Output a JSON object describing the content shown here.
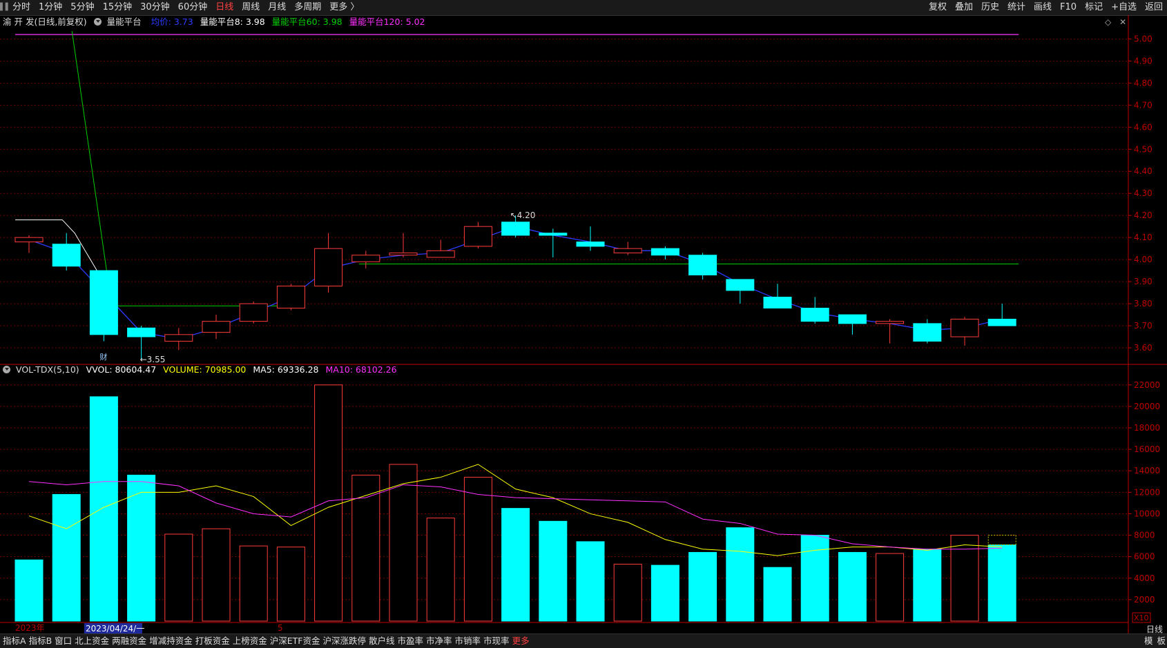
{
  "toolbar": {
    "periods": [
      "分时",
      "1分钟",
      "5分钟",
      "15分钟",
      "30分钟",
      "60分钟",
      "日线",
      "周线",
      "月线",
      "多周期",
      "更多 〉"
    ],
    "active_period": "日线",
    "right_items": [
      "复权",
      "叠加",
      "历史",
      "统计",
      "画线",
      "F10",
      "标记",
      "+自选",
      "返回"
    ]
  },
  "price_header": {
    "stock": "渝 开 发(日线,前复权)",
    "indicator": "量能平台",
    "items": [
      {
        "label": "均价: 3.73",
        "color": "#2a3cff"
      },
      {
        "label": "量能平台8: 3.98",
        "color": "#ffffff"
      },
      {
        "label": "量能平台60: 3.98",
        "color": "#00d000"
      },
      {
        "label": "量能平台120: 5.02",
        "color": "#ff30ff"
      }
    ]
  },
  "volume_header": {
    "name": "VOL-TDX(5,10)",
    "items": [
      {
        "label": "VVOL: 80604.47",
        "color": "#ffffff"
      },
      {
        "label": "VOLUME: 70985.00",
        "color": "#ffff00"
      },
      {
        "label": "MA5: 69336.28",
        "color": "#ffffff"
      },
      {
        "label": "MA10: 68102.26",
        "color": "#ff30ff"
      }
    ]
  },
  "bottom_tabs": [
    "指标A",
    "指标B",
    "窗口",
    "北上资金",
    "两融资金",
    "增减持资金",
    "打板资金",
    "上榜资金",
    "沪深ETF资金",
    "沪深涨跌停",
    "散户线",
    "市盈率",
    "市净率",
    "市销率",
    "市现率",
    "更多"
  ],
  "bottom_right": [
    "模",
    "板"
  ],
  "period_label": "日线",
  "axis_labels": {
    "date_start": "2023年",
    "date_cursor": "2023/04/24/一",
    "month_marker": "5",
    "fin_marker": "财",
    "vol_unit": "X10"
  },
  "annotations": {
    "high": "4.20",
    "low": "3.55"
  },
  "colors": {
    "up": "#ff3b3b",
    "down": "#00ffff",
    "avg_line": "#2a3cff",
    "ma5": "#ffff00",
    "ma10": "#ff30ff",
    "plat8": "#ffffff",
    "plat60": "#00d000",
    "plat120": "#ff30ff",
    "axis": "#c00000"
  },
  "chart_data": [
    {
      "type": "candlestick",
      "title": "渝 开 发(日线,前复权)",
      "y_ticks": [
        3.6,
        3.7,
        3.8,
        3.9,
        4.0,
        4.1,
        4.2,
        4.3,
        4.4,
        4.5,
        4.6,
        4.7,
        4.8,
        4.9,
        5.0
      ],
      "ylim": [
        3.55,
        5.02
      ],
      "candles": [
        {
          "o": 4.08,
          "c": 4.1,
          "h": 4.11,
          "l": 4.03
        },
        {
          "o": 4.07,
          "c": 3.97,
          "h": 4.12,
          "l": 3.95
        },
        {
          "o": 3.95,
          "c": 3.66,
          "h": 3.95,
          "l": 3.63
        },
        {
          "o": 3.69,
          "c": 3.65,
          "h": 3.7,
          "l": 3.55
        },
        {
          "o": 3.63,
          "c": 3.66,
          "h": 3.69,
          "l": 3.59
        },
        {
          "o": 3.67,
          "c": 3.72,
          "h": 3.75,
          "l": 3.64
        },
        {
          "o": 3.72,
          "c": 3.8,
          "h": 3.81,
          "l": 3.71
        },
        {
          "o": 3.78,
          "c": 3.88,
          "h": 3.89,
          "l": 3.77
        },
        {
          "o": 3.88,
          "c": 4.05,
          "h": 4.12,
          "l": 3.85
        },
        {
          "o": 3.99,
          "c": 4.02,
          "h": 4.04,
          "l": 3.96
        },
        {
          "o": 4.02,
          "c": 4.03,
          "h": 4.12,
          "l": 4.01
        },
        {
          "o": 4.01,
          "c": 4.04,
          "h": 4.09,
          "l": 4.01
        },
        {
          "o": 4.06,
          "c": 4.15,
          "h": 4.17,
          "l": 4.05
        },
        {
          "o": 4.17,
          "c": 4.11,
          "h": 4.2,
          "l": 4.1
        },
        {
          "o": 4.12,
          "c": 4.11,
          "h": 4.14,
          "l": 4.01
        },
        {
          "o": 4.08,
          "c": 4.06,
          "h": 4.15,
          "l": 4.04
        },
        {
          "o": 4.03,
          "c": 4.05,
          "h": 4.08,
          "l": 4.02
        },
        {
          "o": 4.05,
          "c": 4.02,
          "h": 4.06,
          "l": 4.0
        },
        {
          "o": 4.02,
          "c": 3.93,
          "h": 4.03,
          "l": 3.91
        },
        {
          "o": 3.91,
          "c": 3.86,
          "h": 3.91,
          "l": 3.8
        },
        {
          "o": 3.83,
          "c": 3.78,
          "h": 3.89,
          "l": 3.78
        },
        {
          "o": 3.78,
          "c": 3.72,
          "h": 3.83,
          "l": 3.71
        },
        {
          "o": 3.75,
          "c": 3.71,
          "h": 3.75,
          "l": 3.66
        },
        {
          "o": 3.71,
          "c": 3.72,
          "h": 3.73,
          "l": 3.62
        },
        {
          "o": 3.71,
          "c": 3.63,
          "h": 3.73,
          "l": 3.62
        },
        {
          "o": 3.65,
          "c": 3.73,
          "h": 3.74,
          "l": 3.61
        },
        {
          "o": 3.73,
          "c": 3.7,
          "h": 3.8,
          "l": 3.7
        }
      ],
      "avg_line": [
        4.09,
        4.03,
        3.85,
        3.67,
        3.64,
        3.69,
        3.76,
        3.83,
        3.96,
        4.0,
        4.02,
        4.03,
        4.09,
        4.15,
        4.11,
        4.08,
        4.04,
        4.04,
        3.98,
        3.89,
        3.82,
        3.76,
        3.73,
        3.71,
        3.68,
        3.69,
        3.73
      ],
      "platform_lines": [
        {
          "name": "量能平台8",
          "value": 3.98,
          "from": 9,
          "to": 26
        },
        {
          "name": "量能平台60",
          "value": 3.98,
          "from": 9,
          "to": 26
        },
        {
          "name": "量能平台120",
          "value": 5.02,
          "from": 0,
          "to": 26
        }
      ]
    },
    {
      "type": "bar",
      "title": "VOL-TDX(5,10)",
      "y_ticks": [
        2000,
        4000,
        6000,
        8000,
        10000,
        12000,
        14000,
        16000,
        18000,
        20000,
        22000
      ],
      "ylim": [
        0,
        22500
      ],
      "values": [
        5700,
        11800,
        20900,
        13600,
        8100,
        8600,
        7000,
        6900,
        22000,
        13600,
        14600,
        9600,
        13400,
        10500,
        9300,
        7400,
        5300,
        5200,
        6400,
        8700,
        5000,
        8000,
        6400,
        6300,
        6700,
        8000,
        7100
      ],
      "up": [
        false,
        false,
        false,
        false,
        true,
        true,
        true,
        true,
        true,
        true,
        true,
        true,
        true,
        false,
        false,
        false,
        true,
        false,
        false,
        false,
        false,
        false,
        false,
        true,
        false,
        true,
        false
      ],
      "ma5": [
        9800,
        8600,
        10600,
        12000,
        12000,
        12600,
        11600,
        8900,
        10600,
        11700,
        12800,
        13400,
        14600,
        12300,
        11500,
        10000,
        9200,
        7600,
        6700,
        6500,
        6100,
        6600,
        6900,
        6900,
        6600,
        7100,
        6900
      ],
      "ma10": [
        13000,
        12700,
        13000,
        13000,
        12600,
        11000,
        10000,
        9700,
        11200,
        11500,
        12700,
        12500,
        11800,
        11500,
        11400,
        11300,
        11200,
        11100,
        9500,
        9100,
        8100,
        8000,
        7200,
        6900,
        6700,
        6700,
        6800
      ]
    }
  ]
}
